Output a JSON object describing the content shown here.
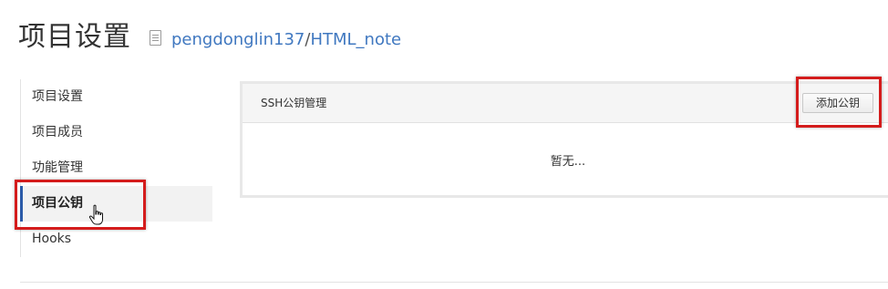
{
  "header": {
    "title": "项目设置",
    "owner": "pengdonglin137",
    "separator": "/",
    "repo": "HTML_note"
  },
  "sidebar": {
    "items": [
      {
        "label": "项目设置",
        "active": false
      },
      {
        "label": "项目成员",
        "active": false
      },
      {
        "label": "功能管理",
        "active": false
      },
      {
        "label": "项目公钥",
        "active": true
      },
      {
        "label": "Hooks",
        "active": false
      }
    ]
  },
  "panel": {
    "title": "SSH公钥管理",
    "add_button_label": "添加公钥",
    "empty_text": "暂无..."
  },
  "colors": {
    "accent": "#2b5ba8",
    "link": "#4078c0",
    "highlight": "#d41c1c"
  },
  "icons": [
    "document-icon",
    "hand-cursor-icon"
  ]
}
